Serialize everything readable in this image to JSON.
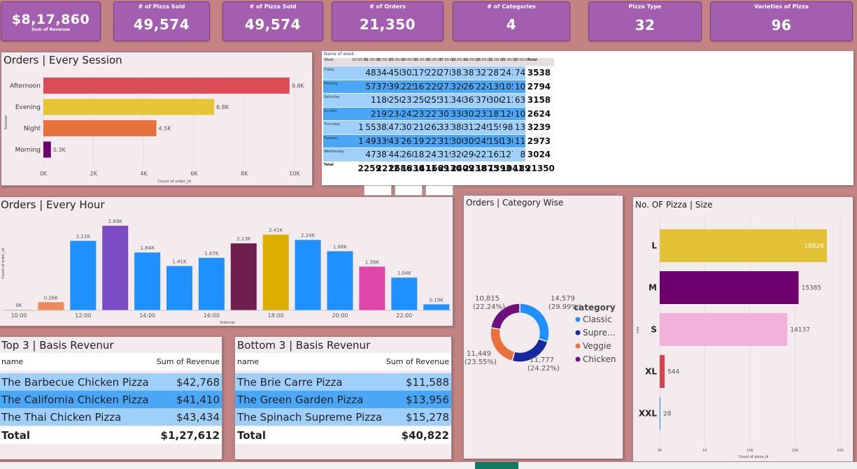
{
  "kpis": [
    {
      "label": "Sum of Revenue",
      "value": "$8,17,860"
    },
    {
      "label": "# of Pizza Sold",
      "value": "49,574"
    },
    {
      "label": "# of Pizza Sold",
      "value": "49,574"
    },
    {
      "label": "# of Orders",
      "value": "21,350"
    },
    {
      "label": "# of Categories",
      "value": "4"
    },
    {
      "label": "Pizza Type",
      "value": "32"
    },
    {
      "label": "Varieties of Pizza",
      "value": "96"
    }
  ],
  "session_chart": {
    "title": "Orders | Every Session",
    "ylabel": "Session",
    "xlabel": "Count of order_id",
    "categories": [
      "Afternoon",
      "Evening",
      "Night",
      "Morning"
    ],
    "values": [
      9800,
      6800,
      4500,
      300
    ],
    "data_labels": [
      "9.8K",
      "6.8K",
      "4.5K",
      "0.3K"
    ],
    "colors": [
      "#dd4b55",
      "#e5c435",
      "#e8703c",
      "#6e006e"
    ],
    "ticks": [
      "0K",
      "2K",
      "4K",
      "6K",
      "8K",
      "10K"
    ],
    "tick_values": [
      0,
      2000,
      4000,
      6000,
      8000,
      10000
    ],
    "xlim": [
      0,
      10000
    ]
  },
  "matrix": {
    "caption": "Name of week",
    "corner": "Week",
    "hours": [
      "10:00:00",
      "11:00:00",
      "12:00:00",
      "13:00:00",
      "14:00:00",
      "15:00:00",
      "16:00:00",
      "17:00:00",
      "18:00:00",
      "19:00:00",
      "20:00:00",
      "21:00:00",
      "22:00:00",
      "23:00:00"
    ],
    "total_label": "Total",
    "rows": [
      {
        "day": "Friday",
        "vals": [
          "",
          "48",
          "344",
          "458",
          "302",
          "179",
          "228",
          "278",
          "383",
          "387",
          "327",
          "287",
          "243",
          "74"
        ],
        "total": "3538"
      },
      {
        "day": "Monday",
        "vals": [
          "",
          "57",
          "379",
          "393",
          "225",
          "167",
          "229",
          "273",
          "326",
          "267",
          "224",
          "139",
          "105",
          "10"
        ],
        "total": "2794"
      },
      {
        "day": "Saturday",
        "vals": [
          "",
          "1",
          "186",
          "250",
          "231",
          "250",
          "255",
          "313",
          "348",
          "367",
          "376",
          "306",
          "212",
          "63"
        ],
        "total": "3158"
      },
      {
        "day": "Sunday",
        "vals": [
          "",
          "2",
          "195",
          "234",
          "242",
          "233",
          "227",
          "301",
          "338",
          "302",
          "233",
          "181",
          "126",
          "10"
        ],
        "total": "2624"
      },
      {
        "day": "Thursday",
        "vals": [
          "1",
          "55",
          "382",
          "472",
          "307",
          "210",
          "262",
          "331",
          "388",
          "312",
          "249",
          "159",
          "98",
          "13"
        ],
        "total": "3239"
      },
      {
        "day": "Tuesday",
        "vals": [
          "1",
          "49",
          "339",
          "437",
          "261",
          "191",
          "227",
          "315",
          "300",
          "309",
          "245",
          "158",
          "130",
          "11"
        ],
        "total": "2973"
      },
      {
        "day": "Wednesday",
        "vals": [
          "",
          "47",
          "387",
          "442",
          "268",
          "181",
          "241",
          "319",
          "326",
          "294",
          "221",
          "163",
          "127",
          "8"
        ],
        "total": "3024"
      }
    ],
    "totals_row": {
      "label": "Total",
      "vals": [
        "2",
        "259",
        "2212",
        "2686",
        "1836",
        "1411",
        "1669",
        "2130",
        "2409",
        "2238",
        "1875",
        "1393",
        "1041",
        "189"
      ],
      "total": "21350"
    }
  },
  "hour_chart": {
    "title": "Orders | Every Hour",
    "ylabel": "Count of order_id",
    "xlabel": "Interval",
    "values": [
      0,
      260,
      2210,
      2690,
      1840,
      1410,
      1670,
      2130,
      2410,
      2240,
      1880,
      1390,
      1040,
      190
    ],
    "data_labels": [
      "0K",
      "0.26K",
      "2.21K",
      "2.69K",
      "1.84K",
      "1.41K",
      "1.67K",
      "2.13K",
      "2.41K",
      "2.24K",
      "1.88K",
      "1.39K",
      "1.04K",
      "0.19K"
    ],
    "colors": [
      "#e9b07a",
      "#f08a5d",
      "#1e90ff",
      "#7b4cc4",
      "#1e90ff",
      "#1e90ff",
      "#1e90ff",
      "#6e1f4e",
      "#dcaf00",
      "#1e90ff",
      "#1e90ff",
      "#e045a8",
      "#1e90ff",
      "#1e90ff"
    ],
    "tick_labels": [
      "10:00",
      "",
      "12:00",
      "",
      "14:00",
      "",
      "16:00",
      "",
      "18:00",
      "",
      "20:00",
      "",
      "22:00",
      ""
    ]
  },
  "top3": {
    "title": "Top 3 | Basis Revenur",
    "col_name": "name",
    "col_rev": "Sum of Revenue",
    "rows": [
      {
        "name": "The Barbecue Chicken Pizza",
        "rev": "$42,768"
      },
      {
        "name": "The California Chicken Pizza",
        "rev": "$41,410"
      },
      {
        "name": "The Thai Chicken Pizza",
        "rev": "$43,434"
      }
    ],
    "total_label": "Total",
    "total": "$1,27,612"
  },
  "bottom3": {
    "title": "Bottom 3 | Basis Revenur",
    "col_name": "name",
    "col_rev": "Sum of Revenue",
    "rows": [
      {
        "name": "The Brie Carre Pizza",
        "rev": "$11,588"
      },
      {
        "name": "The Green Garden Pizza",
        "rev": "$13,956"
      },
      {
        "name": "The Spinach Supreme Pizza",
        "rev": "$15,278"
      }
    ],
    "total_label": "Total",
    "total": "$40,822"
  },
  "category_chart": {
    "title": "Orders | Category Wise",
    "legend_title": "category",
    "slices": [
      {
        "name": "Classic",
        "value": 14579,
        "label": "14,579",
        "pct": "(29.99%)",
        "color": "#1e90ff"
      },
      {
        "name": "Supre...",
        "value": 11777,
        "label": "11,777",
        "pct": "(24.22%)",
        "color": "#1428a0"
      },
      {
        "name": "Veggie",
        "value": 11449,
        "label": "11,449",
        "pct": "(23.55%)",
        "color": "#e8703c"
      },
      {
        "name": "Chicken",
        "value": 10815,
        "label": "10,815",
        "pct": "(22.24%)",
        "color": "#6e0f7e"
      }
    ]
  },
  "size_chart": {
    "title": "No. OF Pizza | Size",
    "ylabel": "size",
    "xlabel": "Count of pizza_id",
    "categories": [
      "L",
      "M",
      "S",
      "XL",
      "XXL"
    ],
    "values": [
      18526,
      15385,
      14137,
      544,
      28
    ],
    "data_labels": [
      "18526",
      "15385",
      "14137",
      "544",
      "28"
    ],
    "colors": [
      "#e3c335",
      "#6e006e",
      "#f2b2dc",
      "#d7424c",
      "#1e90ff"
    ],
    "ticks": [
      "0K",
      "5K",
      "10K",
      "15K",
      "20K"
    ],
    "tick_values": [
      0,
      5000,
      10000,
      15000,
      20000
    ],
    "xlim": [
      0,
      20000
    ]
  }
}
